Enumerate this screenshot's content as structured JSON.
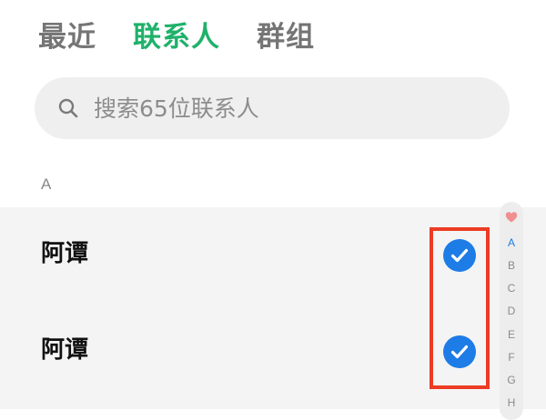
{
  "tabs": [
    {
      "label": "最近",
      "active": false
    },
    {
      "label": "联系人",
      "active": true
    },
    {
      "label": "群组",
      "active": false
    }
  ],
  "search": {
    "placeholder": "搜索65位联系人",
    "icon": "search-icon"
  },
  "section": {
    "header": "A"
  },
  "contacts": [
    {
      "name": "阿谭",
      "checked": true
    },
    {
      "name": "阿谭",
      "checked": true
    }
  ],
  "index_bar": {
    "favorites_icon": "heart-icon",
    "letters": [
      "A",
      "B",
      "C",
      "D",
      "E",
      "F",
      "G",
      "H"
    ],
    "active_letter": "A"
  },
  "colors": {
    "accent_green": "#1fb16a",
    "check_blue": "#1e7ce6",
    "highlight_red": "#ec3c24"
  }
}
